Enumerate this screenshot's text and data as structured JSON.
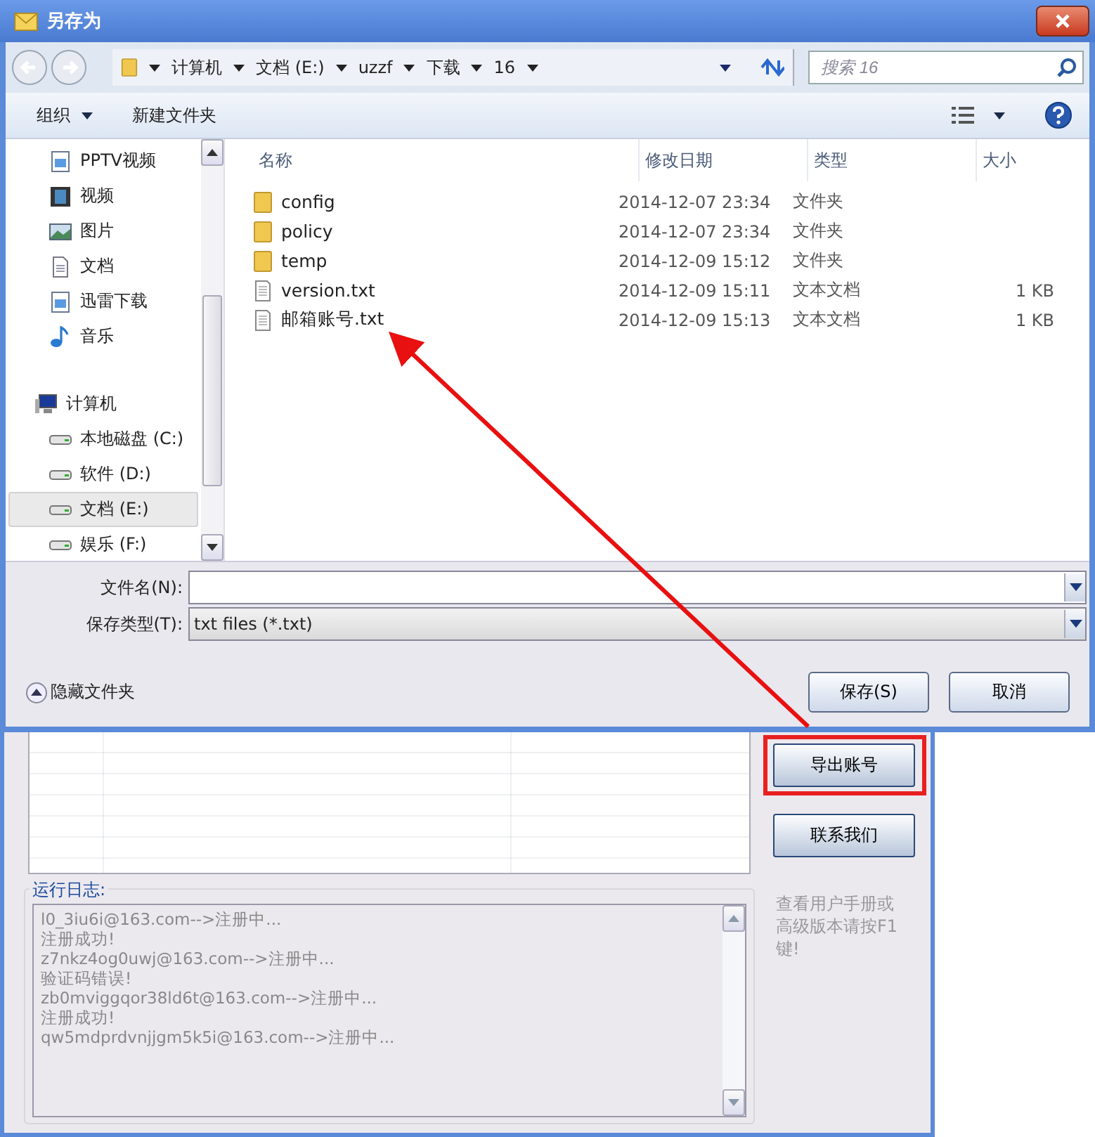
{
  "dialog": {
    "title": "另存为",
    "nav": {
      "breadcrumb": [
        "计算机",
        "文档 (E:)",
        "uzzf",
        "下载",
        "16"
      ],
      "search_placeholder": "搜索 16"
    },
    "toolbar": {
      "organize": "组织",
      "new_folder": "新建文件夹"
    },
    "sidebar": {
      "items": [
        {
          "kind": "pptv",
          "label": "PPTV视频",
          "selected": false
        },
        {
          "kind": "video",
          "label": "视频",
          "selected": false
        },
        {
          "kind": "picture",
          "label": "图片",
          "selected": false
        },
        {
          "kind": "document",
          "label": "文档",
          "selected": false
        },
        {
          "kind": "download",
          "label": "迅雷下载",
          "selected": false
        },
        {
          "kind": "music",
          "label": "音乐",
          "selected": false
        },
        {
          "kind": "computer",
          "label": "计算机",
          "selected": false,
          "children": [
            {
              "kind": "drive",
              "label": "本地磁盘 (C:)",
              "selected": false
            },
            {
              "kind": "drive",
              "label": "软件 (D:)",
              "selected": false
            },
            {
              "kind": "drive",
              "label": "文档 (E:)",
              "selected": true
            },
            {
              "kind": "drive",
              "label": "娱乐 (F:)",
              "selected": false
            }
          ]
        }
      ]
    },
    "file_list": {
      "columns": [
        "名称",
        "修改日期",
        "类型",
        "大小"
      ],
      "rows": [
        {
          "kind": "folder",
          "name": "config",
          "date": "2014-12-07 23:34",
          "type": "文件夹"
        },
        {
          "kind": "folder",
          "name": "policy",
          "date": "2014-12-07 23:34",
          "type": "文件夹"
        },
        {
          "kind": "folder",
          "name": "temp",
          "date": "2014-12-09 15:12",
          "type": "文件夹"
        },
        {
          "kind": "file",
          "name": "version.txt",
          "date": "2014-12-09 15:11",
          "type": "文本文档",
          "size": "1 KB"
        },
        {
          "kind": "file",
          "name": "邮箱账号.txt",
          "date": "2014-12-09 15:13",
          "type": "文本文档",
          "size": "1 KB"
        }
      ]
    },
    "filename": {
      "label": "文件名(N):"
    },
    "filetype": {
      "label": "保存类型(T):",
      "value": "txt files (*.txt)"
    },
    "hide_folders": "隐藏文件夹",
    "buttons": [
      "保存(S)",
      "取消"
    ]
  },
  "app": {
    "log_title": "运行日志:",
    "log_lines": [
      "l0_3iu6i@163.com-->注册中...",
      "注册成功!",
      "z7nkz4og0uwj@163.com-->注册中...",
      "验证码错误!",
      "zb0mviggqor38ld6t@163.com-->注册中...",
      "注册成功!",
      "qw5mdprdvnjjgm5k5i@163.com-->注册中..."
    ],
    "buttons": [
      {
        "label": "导出账号",
        "highlighted": true
      },
      {
        "label": "联系我们",
        "highlighted": false
      }
    ],
    "hint": "查看用户手册或高级版本请按F1键!"
  }
}
